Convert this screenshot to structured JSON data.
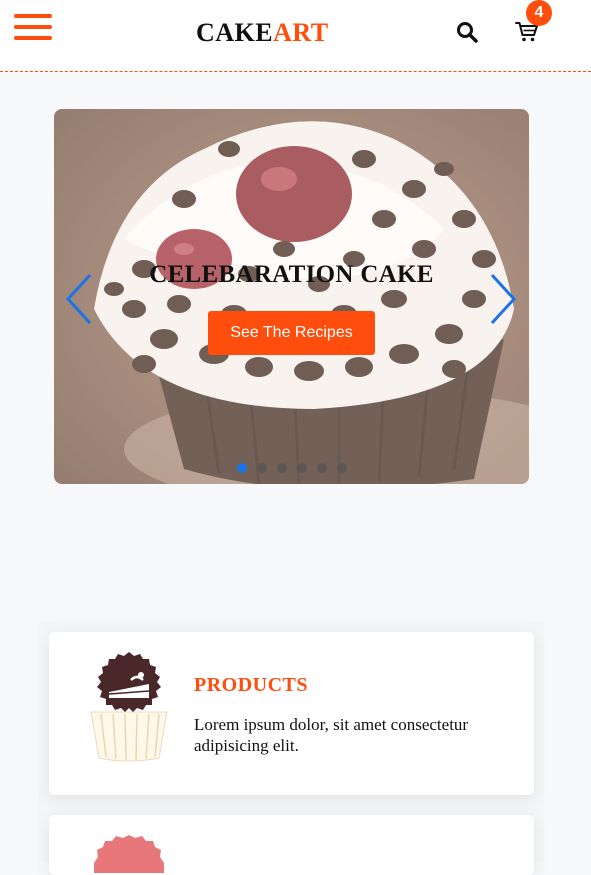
{
  "header": {
    "logo_part1": "CAKE",
    "logo_part2": "ART",
    "cart_count": "4",
    "icons": [
      "menu-icon",
      "search-icon",
      "cart-icon"
    ],
    "accent_color": "#ff4d0d"
  },
  "slider": {
    "title": "CELEBARATION CAKE",
    "button_label": "See The Recipes",
    "slide_count": 6,
    "active_slide": 1,
    "arrow_color": "#1a73e8"
  },
  "features": {
    "cards": [
      {
        "title": "PRODUCTS",
        "text": "Lorem ipsum dolor, sit amet consectetur adipisicing elit.",
        "icon": "cake-slice-icon"
      }
    ]
  }
}
